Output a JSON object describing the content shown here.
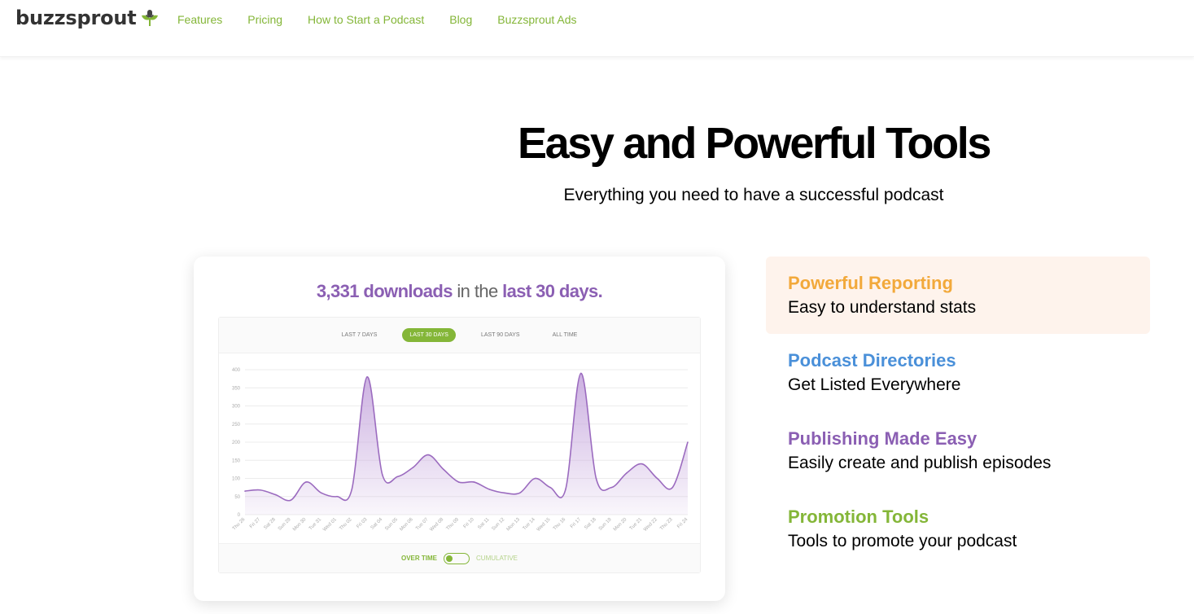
{
  "header": {
    "logo_text": "buzzsprout",
    "nav": [
      "Features",
      "Pricing",
      "How to Start a Podcast",
      "Blog",
      "Buzzsprout Ads"
    ]
  },
  "hero": {
    "title": "Easy and Powerful Tools",
    "subtitle": "Everything you need to have a successful podcast"
  },
  "stats_card": {
    "downloads": "3,331 downloads",
    "in_the": "in the",
    "period": "last 30 days.",
    "tabs": [
      "LAST 7 DAYS",
      "LAST 30 DAYS",
      "LAST 90 DAYS",
      "ALL TIME"
    ],
    "active_tab": "LAST 30 DAYS",
    "toggle_left": "OVER TIME",
    "toggle_right": "CUMULATIVE"
  },
  "chart_data": {
    "type": "area",
    "x": [
      "Thu 26",
      "Fri 27",
      "Sat 28",
      "Sun 29",
      "Mon 30",
      "Tue 31",
      "Wed 01",
      "Thu 02",
      "Fri 03",
      "Sat 04",
      "Sun 05",
      "Mon 06",
      "Tue 07",
      "Wed 08",
      "Thu 09",
      "Fri 10",
      "Sat 11",
      "Sun 12",
      "Mon 13",
      "Tue 14",
      "Wed 15",
      "Thu 16",
      "Fri 17",
      "Sat 18",
      "Sun 19",
      "Mon 20",
      "Tue 21",
      "Wed 22",
      "Thu 23",
      "Fri 24"
    ],
    "series": [
      {
        "values": [
          65,
          68,
          55,
          40,
          90,
          60,
          50,
          70,
          380,
          110,
          105,
          130,
          165,
          125,
          90,
          90,
          70,
          60,
          60,
          100,
          75,
          70,
          390,
          100,
          75,
          115,
          140,
          100,
          75,
          200
        ]
      }
    ],
    "ylim": [
      0,
      400
    ],
    "yticks": [
      0,
      50,
      100,
      150,
      200,
      250,
      300,
      350,
      400
    ],
    "grid": true,
    "colors": {
      "line": "#9b6bbf",
      "fill": "#c9acdf"
    }
  },
  "features": [
    {
      "title": "Powerful Reporting",
      "desc": "Easy to understand stats",
      "color": "#f2a93b",
      "active": true
    },
    {
      "title": "Podcast Directories",
      "desc": "Get Listed Everywhere",
      "color": "#4a90d9",
      "active": false
    },
    {
      "title": "Publishing Made Easy",
      "desc": "Easily create and publish episodes",
      "color": "#8b5fb3",
      "active": false
    },
    {
      "title": "Promotion Tools",
      "desc": "Tools to promote your podcast",
      "color": "#84b638",
      "active": false
    }
  ]
}
